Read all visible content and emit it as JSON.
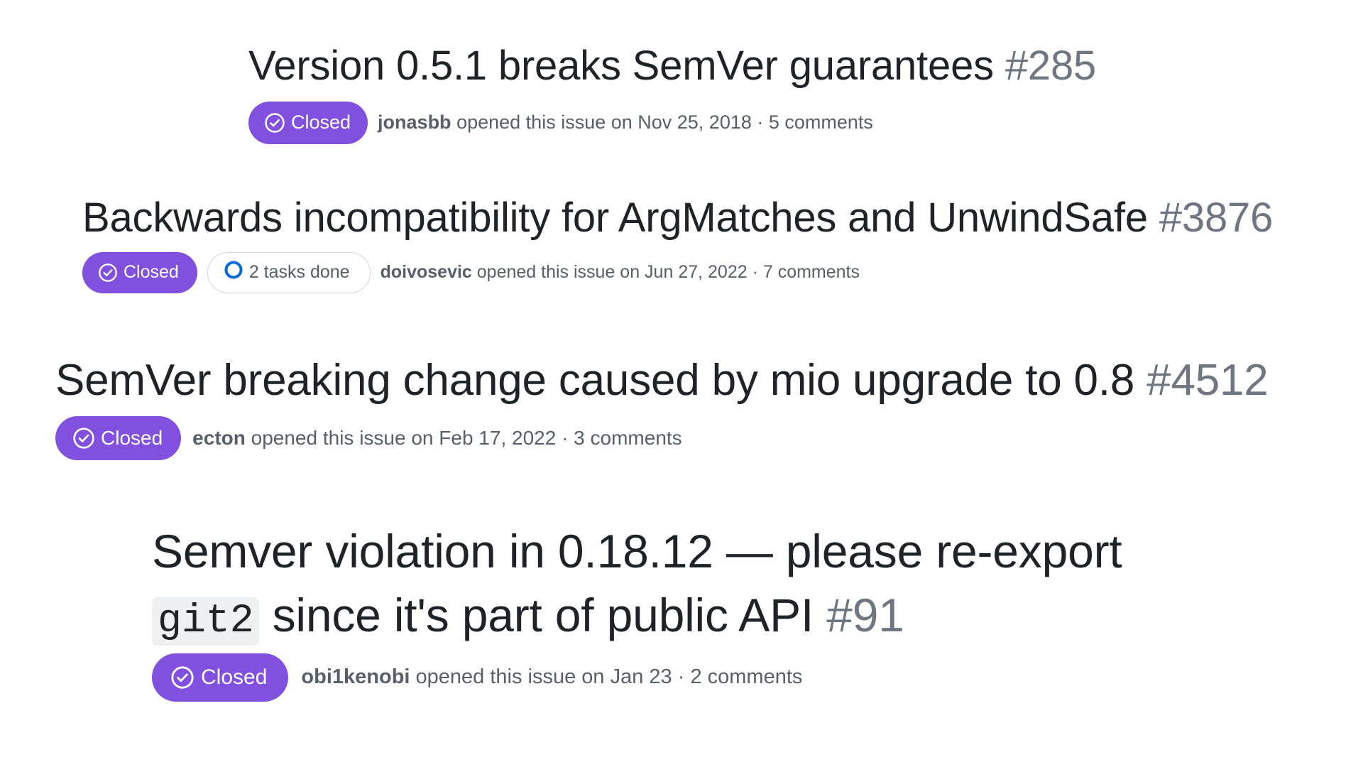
{
  "issues": [
    {
      "title": "Version 0.5.1 breaks SemVer guarantees",
      "number": "#285",
      "state": "Closed",
      "author": "jonasbb",
      "opened_text": "opened this issue on Nov 25, 2018 · 5 comments"
    },
    {
      "title": "Backwards incompatibility for ArgMatches and UnwindSafe",
      "number": "#3876",
      "state": "Closed",
      "tasks": "2 tasks done",
      "author": "doivosevic",
      "opened_text": "opened this issue on Jun 27, 2022 · 7 comments"
    },
    {
      "title": "SemVer breaking change caused by mio upgrade to 0.8",
      "number": "#4512",
      "state": "Closed",
      "author": "ecton",
      "opened_text": "opened this issue on Feb 17, 2022 · 3 comments"
    },
    {
      "title_line1": "Semver violation in 0.18.12 — please re-export",
      "title_code": "git2",
      "title_line2_rest": "since it's part of public API",
      "number": "#91",
      "state": "Closed",
      "author": "obi1kenobi",
      "opened_text": "opened this issue on Jan 23 · 2 comments"
    }
  ],
  "colors": {
    "closed_badge": "#8250df",
    "muted_text": "#57606a",
    "issue_number": "#6e7781",
    "tasks_ring": "#0969da"
  },
  "icons": {
    "closed_state": "check-circle-icon",
    "tasks_progress": "progress-ring-icon"
  }
}
